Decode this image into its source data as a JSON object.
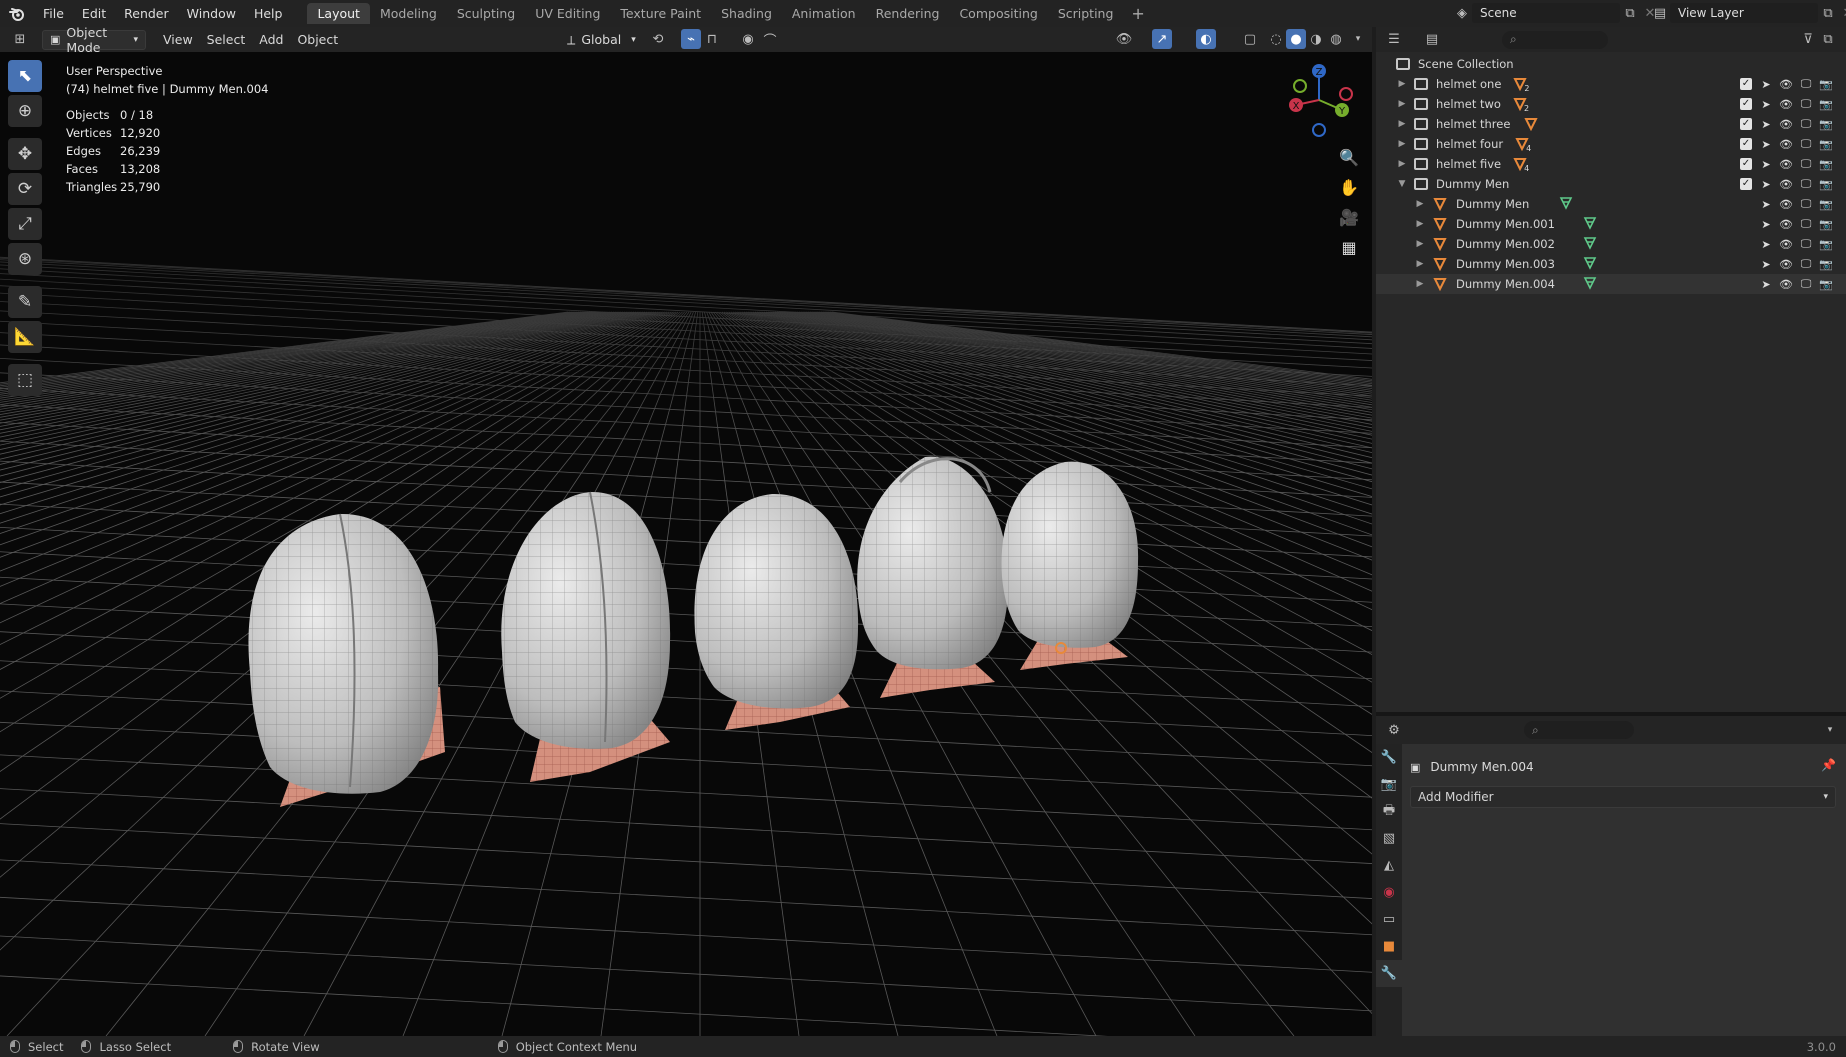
{
  "menu": [
    "File",
    "Edit",
    "Render",
    "Window",
    "Help"
  ],
  "workspaces": [
    {
      "label": "Layout",
      "active": true
    },
    {
      "label": "Modeling"
    },
    {
      "label": "Sculpting"
    },
    {
      "label": "UV Editing"
    },
    {
      "label": "Texture Paint"
    },
    {
      "label": "Shading"
    },
    {
      "label": "Animation"
    },
    {
      "label": "Rendering"
    },
    {
      "label": "Compositing"
    },
    {
      "label": "Scripting"
    }
  ],
  "workspace_add": "+",
  "scene": "Scene",
  "view_layer": "View Layer",
  "viewport_header": {
    "mode": "Object Mode",
    "menus": [
      "View",
      "Select",
      "Add",
      "Object"
    ],
    "transform_orientation": "Global"
  },
  "overlay": {
    "perspective": "User Perspective",
    "context": "(74) helmet five | Dummy Men.004",
    "stats": [
      {
        "label": "Objects",
        "value": "0 / 18"
      },
      {
        "label": "Vertices",
        "value": "12,920"
      },
      {
        "label": "Edges",
        "value": "26,239"
      },
      {
        "label": "Faces",
        "value": "13,208"
      },
      {
        "label": "Triangles",
        "value": "25,790"
      }
    ]
  },
  "gizmo": {
    "x": "X",
    "y": "Y",
    "z": "Z"
  },
  "outliner": {
    "root": "Scene Collection",
    "items": [
      {
        "label": "helmet one",
        "badge": "2",
        "level": 0,
        "expanded": false
      },
      {
        "label": "helmet two",
        "badge": "2",
        "level": 0,
        "expanded": false
      },
      {
        "label": "helmet three",
        "badge": "",
        "level": 0,
        "expanded": false
      },
      {
        "label": "helmet four",
        "badge": "4",
        "level": 0,
        "expanded": false
      },
      {
        "label": "helmet five",
        "badge": "4",
        "level": 0,
        "expanded": false
      },
      {
        "label": "Dummy Men",
        "badge": "",
        "level": 0,
        "expanded": true
      },
      {
        "label": "Dummy Men",
        "level": 1,
        "expanded": false
      },
      {
        "label": "Dummy Men.001",
        "level": 1,
        "expanded": false
      },
      {
        "label": "Dummy Men.002",
        "level": 1,
        "expanded": false
      },
      {
        "label": "Dummy Men.003",
        "level": 1,
        "expanded": false
      },
      {
        "label": "Dummy Men.004",
        "level": 1,
        "expanded": false
      }
    ]
  },
  "properties": {
    "object_name": "Dummy Men.004",
    "add_modifier": "Add Modifier"
  },
  "statusbar": {
    "select": "Select",
    "lasso": "Lasso Select",
    "rotate": "Rotate View",
    "context_menu": "Object Context Menu",
    "version": "3.0.0"
  },
  "colors": {
    "accent": "#4772b3",
    "mesh_orange": "#e8893a",
    "mesh_green": "#5fc98a",
    "helmet": "#c9c9c9",
    "neck": "#d98f7a"
  }
}
